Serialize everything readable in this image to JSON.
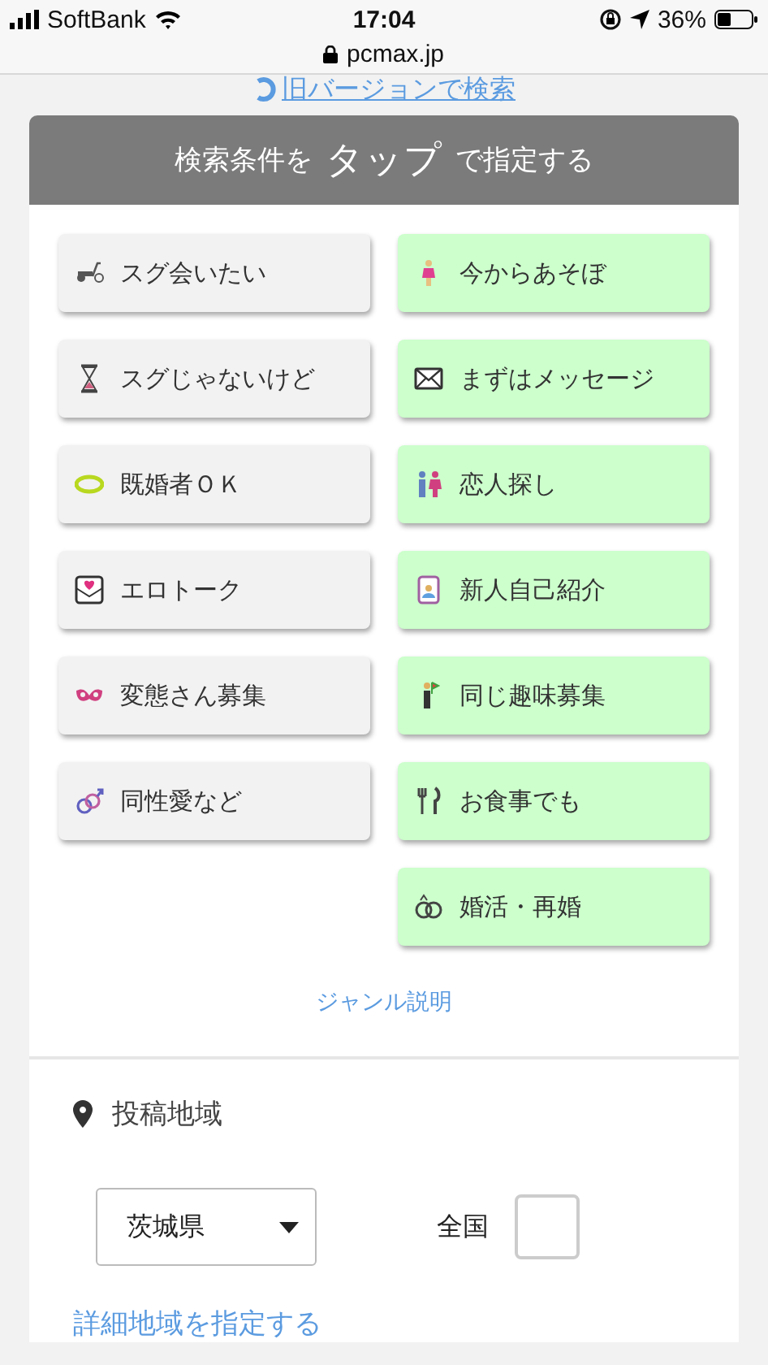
{
  "status_bar": {
    "carrier": "SoftBank",
    "time": "17:04",
    "battery": "36%",
    "url": "pcmax.jp"
  },
  "old_version_link": "旧バージョンで検索",
  "search_card": {
    "header": {
      "before": "検索条件を",
      "emphasis": "タップ",
      "after": "で指定する"
    },
    "genre_columns": [
      [
        {
          "label": "スグ会いたい",
          "selected": false
        },
        {
          "label": "スグじゃないけど",
          "selected": false
        },
        {
          "label": "既婚者ＯＫ",
          "selected": false
        },
        {
          "label": "エロトーク",
          "selected": false
        },
        {
          "label": "変態さん募集",
          "selected": false
        },
        {
          "label": "同性愛など",
          "selected": false
        }
      ],
      [
        {
          "label": "今からあそぼ",
          "selected": true
        },
        {
          "label": "まずはメッセージ",
          "selected": true
        },
        {
          "label": "恋人探し",
          "selected": true
        },
        {
          "label": "新人自己紹介",
          "selected": true
        },
        {
          "label": "同じ趣味募集",
          "selected": true
        },
        {
          "label": "お食事でも",
          "selected": true
        },
        {
          "label": "婚活・再婚",
          "selected": true
        }
      ]
    ],
    "genre_help_link": "ジャンル説明"
  },
  "area": {
    "title": "投稿地域",
    "prefecture": "茨城県",
    "nationwide": {
      "label": "全国",
      "checked": false
    },
    "detail_link": "詳細地域を指定する"
  }
}
